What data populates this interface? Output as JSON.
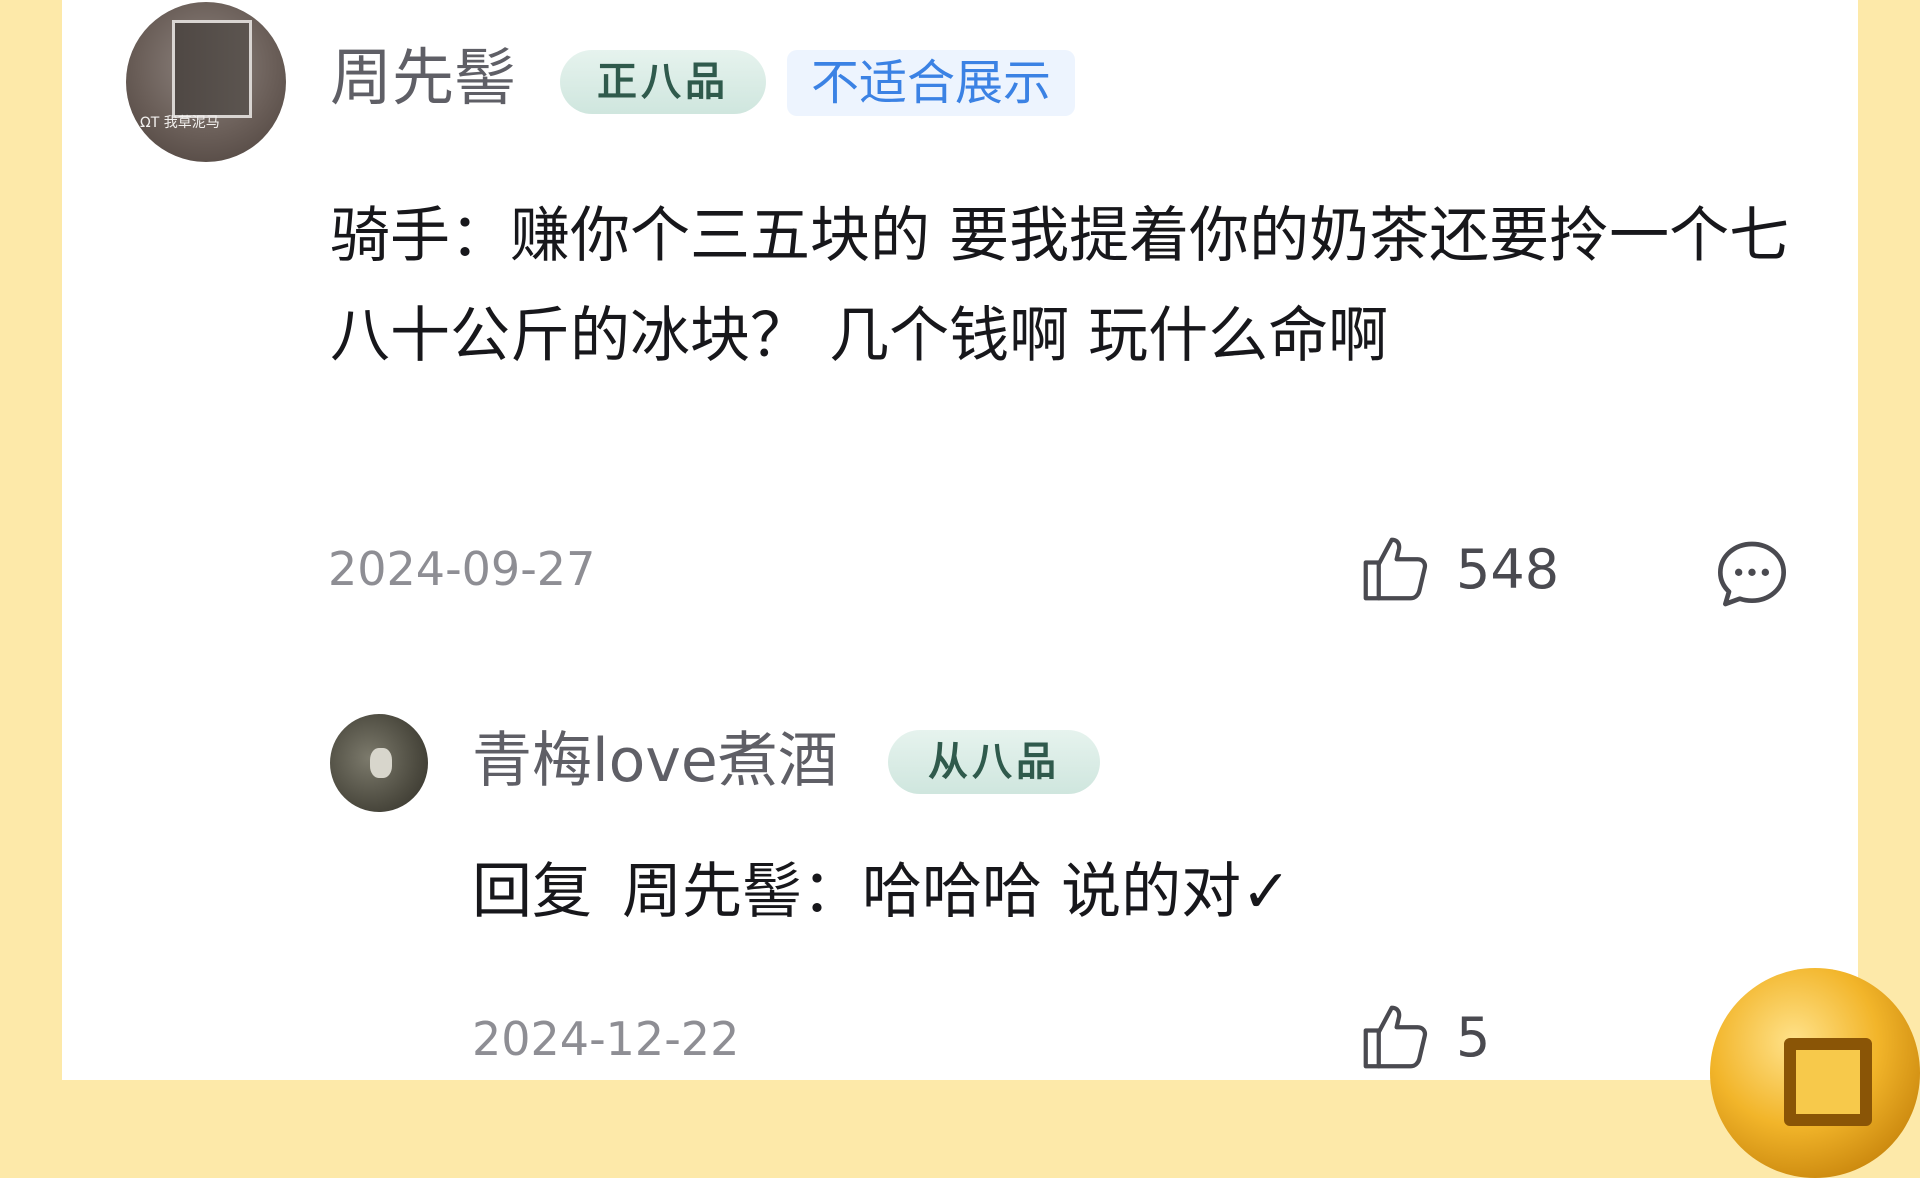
{
  "comment": {
    "author": "周先髻",
    "rank_badge": "正八品",
    "flag_badge": "不适合展示",
    "avatar_caption": "ΩΤ 我草泥马",
    "text": "骑手：赚你个三五块的 要我提着你的奶茶还要拎一个七八十公斤的冰块？ 几个钱啊 玩什么命啊",
    "date": "2024-09-27",
    "like_count": "548"
  },
  "reply": {
    "author": "青梅love煮酒",
    "rank_badge": "从八品",
    "prefix": "回复",
    "text": "周先髻：哈哈哈 说的对✓",
    "date": "2024-12-22",
    "like_count": "5"
  },
  "icons": {
    "like": "thumbs-up-icon",
    "reply": "chat-bubble-icon",
    "coin": "gold-coin-icon"
  },
  "colors": {
    "background": "#fde9a9",
    "card": "#ffffff",
    "flag_badge_text": "#3b82e4",
    "rank_badge_bg": "#d6ebe4"
  }
}
